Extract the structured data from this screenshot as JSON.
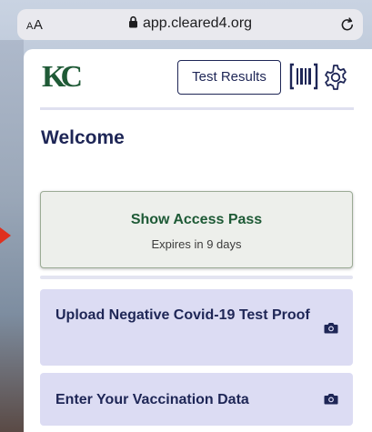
{
  "browser": {
    "text_size_label": "AA",
    "url": "app.cleared4.org"
  },
  "header": {
    "logo_text": "KC",
    "test_results_label": "Test Results"
  },
  "main": {
    "heading": "Welcome",
    "access_pass": {
      "title": "Show Access Pass",
      "subtitle": "Expires in 9 days"
    },
    "actions": [
      {
        "label": "Upload Negative Covid-19 Test Proof",
        "icon": "camera-icon"
      },
      {
        "label": "Enter Your Vaccination Data",
        "icon": "camera-icon"
      }
    ]
  },
  "icons": [
    "lock-icon",
    "reload-icon",
    "barcode-icon",
    "gear-icon",
    "camera-icon"
  ],
  "colors": {
    "brand_green": "#1f5a36",
    "navy": "#1e2656",
    "action_card_bg": "#dcdcf3",
    "access_card_bg": "#edefeb"
  }
}
